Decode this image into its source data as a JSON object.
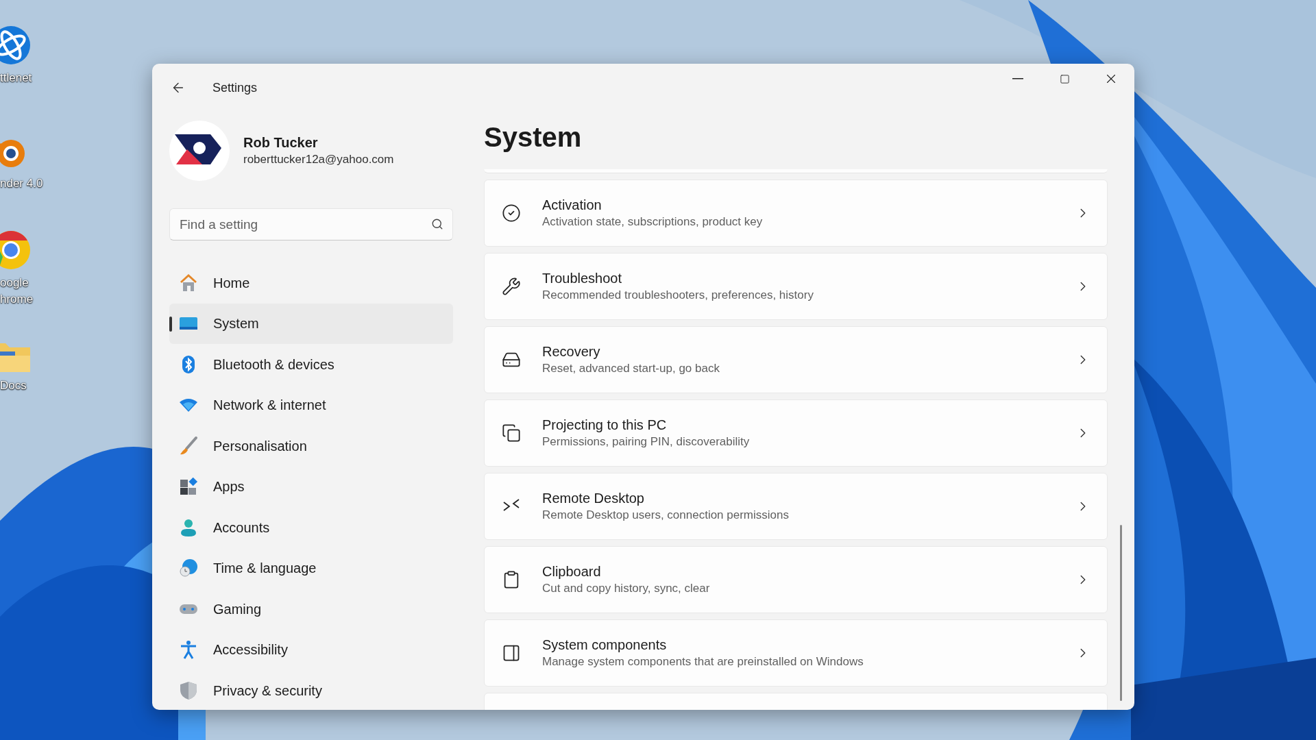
{
  "desktop_icons": [
    {
      "label_lines": [
        "ttlenet"
      ]
    },
    {
      "label_lines": [
        "nder 4.0"
      ]
    },
    {
      "label_lines": [
        "oogle",
        "hrome"
      ]
    },
    {
      "label_lines": [
        "Docs"
      ]
    }
  ],
  "window": {
    "title": "Settings"
  },
  "profile": {
    "name": "Rob Tucker",
    "email": "roberttucker12a@yahoo.com"
  },
  "search": {
    "placeholder": "Find a setting"
  },
  "sidebar": {
    "items": [
      {
        "label": "Home",
        "selected": false
      },
      {
        "label": "System",
        "selected": true
      },
      {
        "label": "Bluetooth & devices",
        "selected": false
      },
      {
        "label": "Network & internet",
        "selected": false
      },
      {
        "label": "Personalisation",
        "selected": false
      },
      {
        "label": "Apps",
        "selected": false
      },
      {
        "label": "Accounts",
        "selected": false
      },
      {
        "label": "Time & language",
        "selected": false
      },
      {
        "label": "Gaming",
        "selected": false
      },
      {
        "label": "Accessibility",
        "selected": false
      },
      {
        "label": "Privacy & security",
        "selected": false
      }
    ]
  },
  "page": {
    "title": "System",
    "items": [
      {
        "title": "Activation",
        "description": "Activation state, subscriptions, product key"
      },
      {
        "title": "Troubleshoot",
        "description": "Recommended troubleshooters, preferences, history"
      },
      {
        "title": "Recovery",
        "description": "Reset, advanced start-up, go back"
      },
      {
        "title": "Projecting to this PC",
        "description": "Permissions, pairing PIN, discoverability"
      },
      {
        "title": "Remote Desktop",
        "description": "Remote Desktop users, connection permissions"
      },
      {
        "title": "Clipboard",
        "description": "Cut and copy history, sync, clear"
      },
      {
        "title": "System components",
        "description": "Manage system components that are preinstalled on Windows"
      }
    ]
  }
}
